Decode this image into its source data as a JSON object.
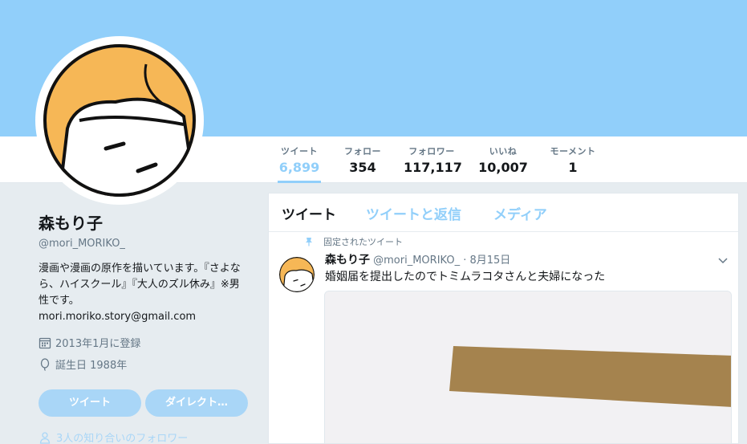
{
  "colors": {
    "banner": "#91cffa",
    "accent": "#91cffa",
    "button": "#a9d6f7",
    "text_secondary": "#657786"
  },
  "stats": [
    {
      "label": "ツイート",
      "value": "6,899"
    },
    {
      "label": "フォロー",
      "value": "354"
    },
    {
      "label": "フォロワー",
      "value": "117,117"
    },
    {
      "label": "いいね",
      "value": "10,007"
    },
    {
      "label": "モーメント",
      "value": "1"
    }
  ],
  "profile": {
    "name": "森もり子",
    "handle": "@mori_MORIKO_",
    "bio": "漫画や漫画の原作を描いています。『さよなら、ハイスクール』『大人のズル休み』※男性です。",
    "email": "mori.moriko.story@gmail.com",
    "joined": "2013年1月に登録",
    "birthday": "誕生日 1988年",
    "tweet_button": "ツイート",
    "dm_button": "ダイレクト…",
    "followers_you_know": "3人の知り合いのフォロワー"
  },
  "icons": {
    "joined": "calendar-icon",
    "birthday": "balloon-icon",
    "followers": "person-icon",
    "pinned": "pin-icon",
    "menu": "chevron-down-icon"
  },
  "timeline": {
    "tabs": [
      "ツイート",
      "ツイートと返信",
      "メディア"
    ],
    "pinned_label": "固定されたツイート",
    "tweet": {
      "name": "森もり子",
      "handle": "@mori_MORIKO_",
      "date": "· 8月15日",
      "text": "婚姻届を提出したのでトミムラコタさんと夫婦になった"
    }
  }
}
